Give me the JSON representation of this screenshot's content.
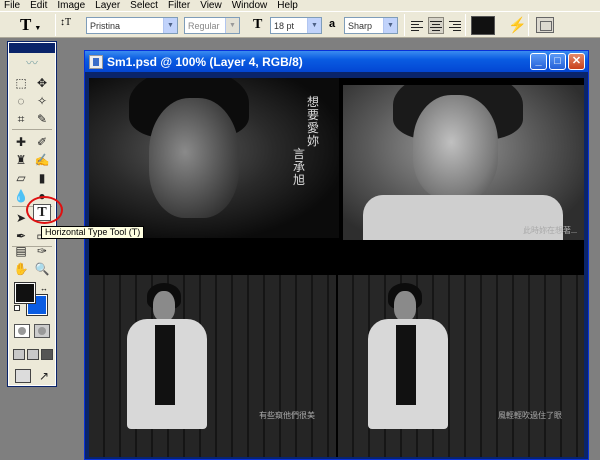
{
  "menu": [
    "File",
    "Edit",
    "Image",
    "Layer",
    "Select",
    "Filter",
    "View",
    "Window",
    "Help"
  ],
  "options": {
    "tool_glyph": "T",
    "orientation_glyph": "↕T",
    "font_family": "Pristina",
    "font_style": "Regular",
    "size_glyph": "T",
    "font_size": "18 pt",
    "aa_glyph": "a",
    "aa_method": "Sharp",
    "text_color": "#111111"
  },
  "toolbox": {
    "active_tool": "T",
    "tooltip": "Horizontal Type Tool (T)",
    "foreground": "#111111",
    "background": "#0a5ce2"
  },
  "document": {
    "title": "Sm1.psd @ 100% (Layer 4, RGB/8)",
    "minimize": "_",
    "maximize": "□",
    "close": "✕"
  },
  "photo": {
    "vertical_title": "想要愛妳",
    "vertical_artist": "言承旭",
    "caption_top_right": "此時妳在想著...",
    "caption_bottom_left": "有些窺他們很美",
    "caption_bottom_right": "風輕輕吹過住了眼"
  }
}
